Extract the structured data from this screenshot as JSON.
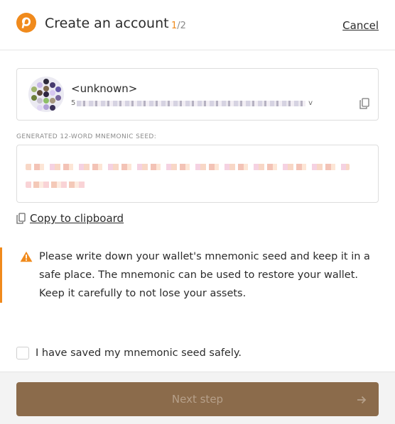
{
  "header": {
    "title": "Create an account",
    "step_current": "1",
    "step_total": "/2",
    "cancel_label": "Cancel"
  },
  "account": {
    "name": "<unknown>",
    "address_first_char": "5",
    "address_last_char": "v",
    "copy_icon": "copy-icon"
  },
  "seed": {
    "label": "GENERATED 12-WORD MNEMONIC SEED:",
    "obscured": true
  },
  "copy_clipboard": {
    "label": "Copy to clipboard",
    "icon": "copy-icon"
  },
  "warning": {
    "icon": "warning-triangle-icon",
    "text": "Please write down your wallet's mnemonic seed and keep it in a safe place. The mnemonic can be used to restore your wallet. Keep it carefully to not lose your assets."
  },
  "confirm": {
    "label": "I have saved my mnemonic seed safely.",
    "checked": false
  },
  "footer": {
    "next_label": "Next step",
    "next_enabled": false,
    "arrow_icon": "arrow-right-icon"
  },
  "colors": {
    "accent": "#f08a1c",
    "button_bg": "#8b6b4b",
    "button_text_disabled": "#b6a08a"
  }
}
